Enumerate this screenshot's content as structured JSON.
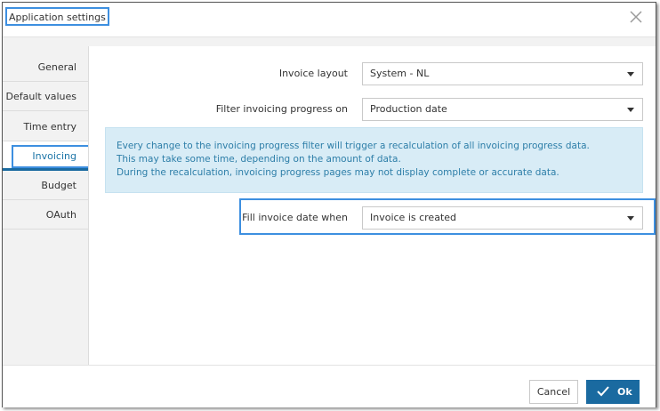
{
  "dialog": {
    "title": "Application settings",
    "close_icon": "close-icon"
  },
  "sidebar": {
    "items": [
      {
        "label": "General"
      },
      {
        "label": "Default values"
      },
      {
        "label": "Time entry"
      },
      {
        "label": "Invoicing"
      },
      {
        "label": "Budget"
      },
      {
        "label": "OAuth"
      }
    ],
    "active_index": 3
  },
  "form": {
    "invoice_layout": {
      "label": "Invoice layout",
      "value": "System - NL"
    },
    "filter_progress": {
      "label": "Filter invoicing progress on",
      "value": "Production date"
    },
    "info": {
      "line1": "Every change to the invoicing progress filter will trigger a recalculation of all invoicing progress data.",
      "line2": "This may take some time, depending on the amount of data.",
      "line3": "During the recalculation, invoicing progress pages may not display complete or accurate data."
    },
    "fill_invoice_date": {
      "label": "Fill invoice date when",
      "value": "Invoice is created"
    }
  },
  "footer": {
    "cancel_label": "Cancel",
    "ok_label": "Ok",
    "ok_icon": "check-icon"
  },
  "colors": {
    "accent": "#1a6aa0",
    "highlight": "#3d8fe0",
    "info_bg": "#d8ecf6",
    "info_text": "#2d7ea8"
  }
}
